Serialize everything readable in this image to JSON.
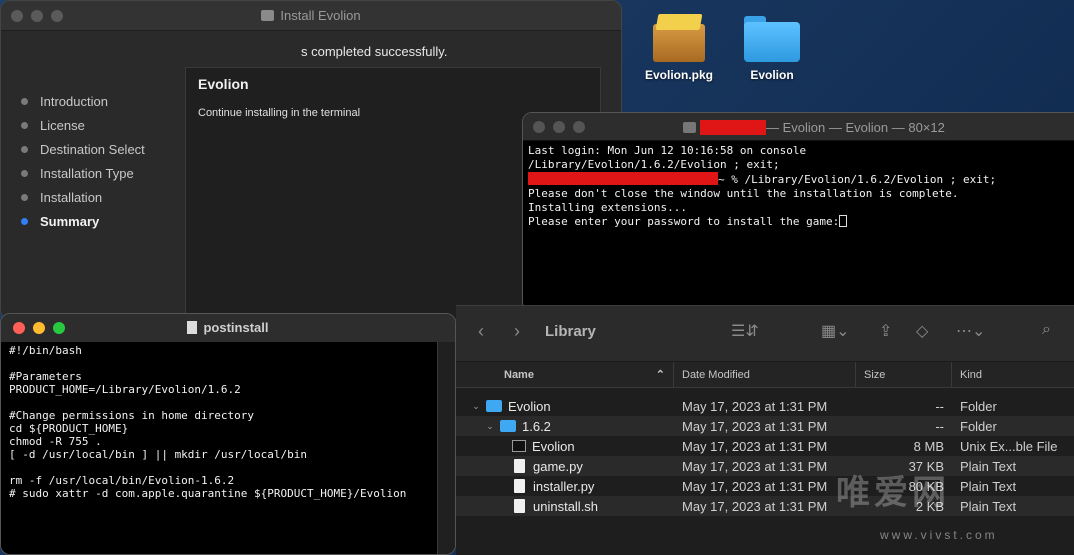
{
  "colors": {
    "accent": "#2f7ff5",
    "close": "#ff5f57",
    "minimize": "#febc2e",
    "zoom": "#28c840",
    "redaction": "#e01515"
  },
  "installer": {
    "title": "Install Evolion",
    "success_message": "s completed successfully.",
    "steps": [
      {
        "label": "Introduction",
        "active": false
      },
      {
        "label": "License",
        "active": false
      },
      {
        "label": "Destination Select",
        "active": false
      },
      {
        "label": "Installation Type",
        "active": false
      },
      {
        "label": "Installation",
        "active": false
      },
      {
        "label": "Summary",
        "active": true
      }
    ],
    "content": {
      "heading": "Evolion",
      "body": "Continue installing in the terminal"
    }
  },
  "desktop": {
    "icons": [
      {
        "label": "Evolion.pkg",
        "icon": "package-icon"
      },
      {
        "label": "Evolion",
        "icon": "folder-icon"
      }
    ]
  },
  "terminal": {
    "title": "— Evolion — Evolion — 80×12",
    "lines": [
      "Last login: Mon Jun 12 10:16:58 on console",
      "/Library/Evolion/1.6.2/Evolion ; exit;",
      "~ % /Library/Evolion/1.6.2/Evolion ; exit;",
      "Please don't close the window until the installation is complete.",
      "Installing extensions...",
      "Please enter your password to install the game:"
    ]
  },
  "finder": {
    "location": "Library",
    "columns": {
      "name": "Name",
      "date": "Date Modified",
      "size": "Size",
      "kind": "Kind"
    },
    "rows": [
      {
        "name": "Evolion",
        "date": "May 17, 2023 at 1:31 PM",
        "size": "--",
        "kind": "Folder",
        "icon": "folder-icon",
        "depth": 0,
        "disclosure": "open"
      },
      {
        "name": "1.6.2",
        "date": "May 17, 2023 at 1:31 PM",
        "size": "--",
        "kind": "Folder",
        "icon": "folder-icon",
        "depth": 1,
        "disclosure": "open"
      },
      {
        "name": "Evolion",
        "date": "May 17, 2023 at 1:31 PM",
        "size": "8 MB",
        "kind": "Unix Ex...ble File",
        "icon": "executable-icon",
        "depth": 2,
        "disclosure": "none"
      },
      {
        "name": "game.py",
        "date": "May 17, 2023 at 1:31 PM",
        "size": "37 KB",
        "kind": "Plain Text",
        "icon": "document-icon",
        "depth": 2,
        "disclosure": "none"
      },
      {
        "name": "installer.py",
        "date": "May 17, 2023 at 1:31 PM",
        "size": "80 KB",
        "kind": "Plain Text",
        "icon": "document-icon",
        "depth": 2,
        "disclosure": "none"
      },
      {
        "name": "uninstall.sh",
        "date": "May 17, 2023 at 1:31 PM",
        "size": "2 KB",
        "kind": "Plain Text",
        "icon": "document-icon",
        "depth": 2,
        "disclosure": "none"
      }
    ]
  },
  "postinstall": {
    "title": "postinstall",
    "script": "#!/bin/bash\n\n#Parameters\nPRODUCT_HOME=/Library/Evolion/1.6.2\n\n#Change permissions in home directory\ncd ${PRODUCT_HOME}\nchmod -R 755 .\n[ -d /usr/local/bin ] || mkdir /usr/local/bin\n\nrm -f /usr/local/bin/Evolion-1.6.2\n# sudo xattr -d com.apple.quarantine ${PRODUCT_HOME}/Evolion"
  },
  "watermark": {
    "text": "唯爱网",
    "url": "www.vivst.com"
  }
}
